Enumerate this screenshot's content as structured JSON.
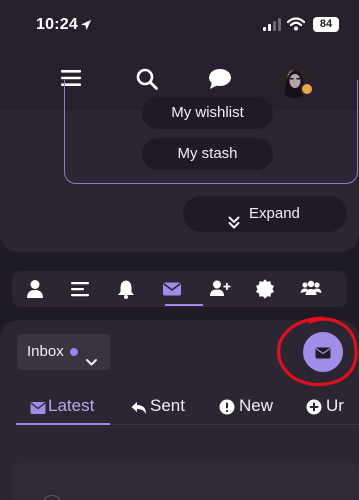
{
  "status_bar": {
    "time": "10:24",
    "battery": "84"
  },
  "header": {
    "menu_icon": "hamburger-icon",
    "search_icon": "search-icon",
    "chat_icon": "chat-bubble-icon"
  },
  "collection": {
    "wishlist_label": "My wishlist",
    "stash_label": "My stash",
    "expand_label": "Expand"
  },
  "profile_tabs": [
    {
      "name": "profile",
      "icon": "user-icon"
    },
    {
      "name": "activity",
      "icon": "list-icon"
    },
    {
      "name": "notifications",
      "icon": "bell-icon"
    },
    {
      "name": "messages",
      "icon": "envelope-icon",
      "active": true
    },
    {
      "name": "invites",
      "icon": "user-plus-icon"
    },
    {
      "name": "badges",
      "icon": "badge-icon"
    },
    {
      "name": "groups",
      "icon": "users-icon"
    }
  ],
  "messages": {
    "folder_label": "Inbox",
    "tabs": [
      {
        "label": "Latest",
        "icon": "envelope-icon",
        "active": true
      },
      {
        "label": "Sent",
        "icon": "reply-icon"
      },
      {
        "label": "New",
        "icon": "exclamation-circle-icon"
      },
      {
        "label": "Ur",
        "icon": "plus-circle-icon"
      }
    ]
  },
  "colors": {
    "background": "#1f1b24",
    "card": "#2b2631",
    "accent": "#a28eea",
    "annotation": "#e0101c"
  }
}
